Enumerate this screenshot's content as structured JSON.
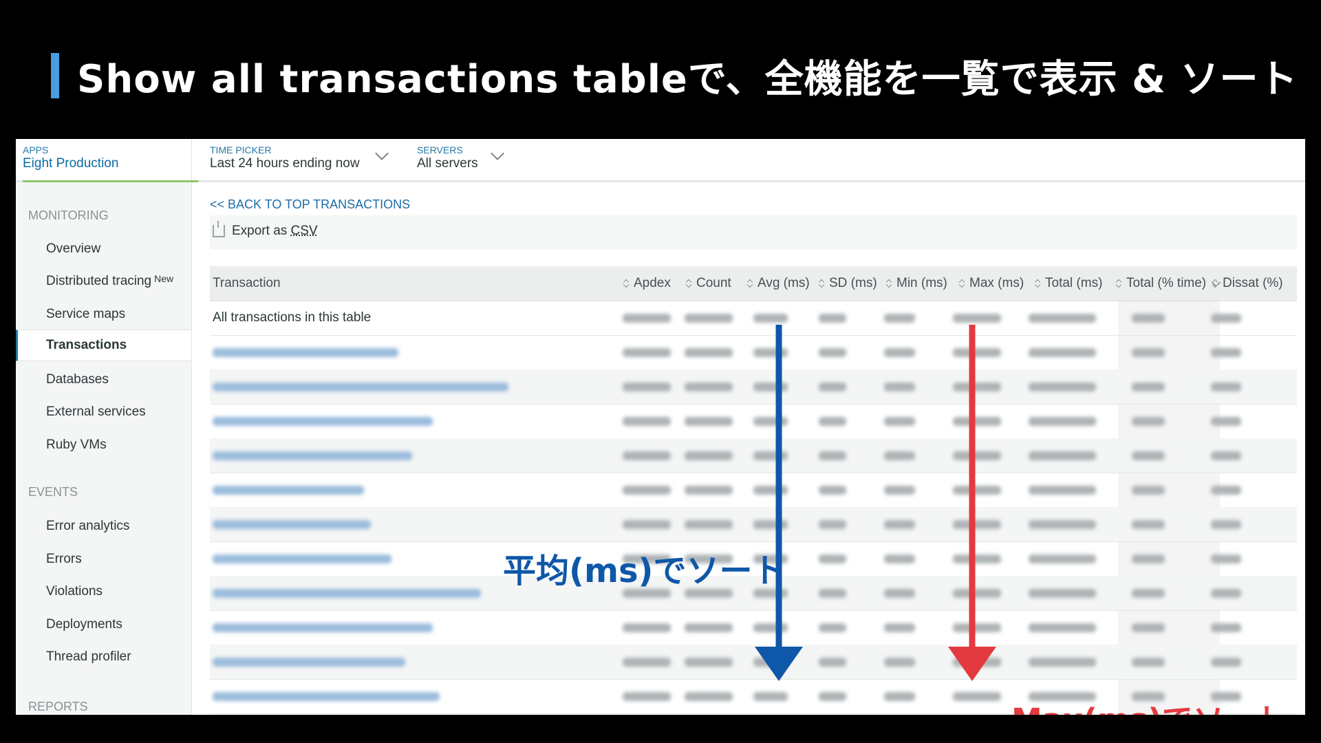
{
  "slide_title": "Show all transactions tableで、全機能を一覧で表示 & ソート",
  "topbar": {
    "apps": {
      "label": "APPS",
      "value": "Eight Production"
    },
    "time_picker": {
      "label": "TIME PICKER",
      "value": "Last 24 hours ending now"
    },
    "servers": {
      "label": "SERVERS",
      "value": "All servers"
    }
  },
  "sidebar": {
    "monitoring_label": "MONITORING",
    "monitoring_items": [
      "Overview",
      "Distributed tracing",
      "Service maps",
      "Transactions",
      "Databases",
      "External services",
      "Ruby VMs"
    ],
    "new_badge": "New",
    "active_item": "Transactions",
    "events_label": "EVENTS",
    "events_items": [
      "Error analytics",
      "Errors",
      "Violations",
      "Deployments",
      "Thread profiler"
    ],
    "reports_label": "REPORTS"
  },
  "main": {
    "back_link": "<< BACK TO TOP TRANSACTIONS",
    "export_prefix": "Export as ",
    "export_csv": "CSV"
  },
  "table": {
    "columns": [
      "Transaction",
      "Apdex",
      "Count",
      "Avg (ms)",
      "SD (ms)",
      "Min (ms)",
      "Max (ms)",
      "Total (ms)",
      "Total (% time)",
      "Dissat (%)"
    ],
    "summary_row": "All transactions in this table",
    "sorted_column": "Total (% time)"
  },
  "annotations": {
    "avg_sort": "平均(ms)でソート",
    "max_sort": "Max(ms)でソート",
    "avg_color": "#0f57a8",
    "max_color": "#e33a3f"
  },
  "colors": {
    "accent_blue": "#4a9ede",
    "link": "#1b6ca8",
    "active_underline": "#8fc46b"
  }
}
